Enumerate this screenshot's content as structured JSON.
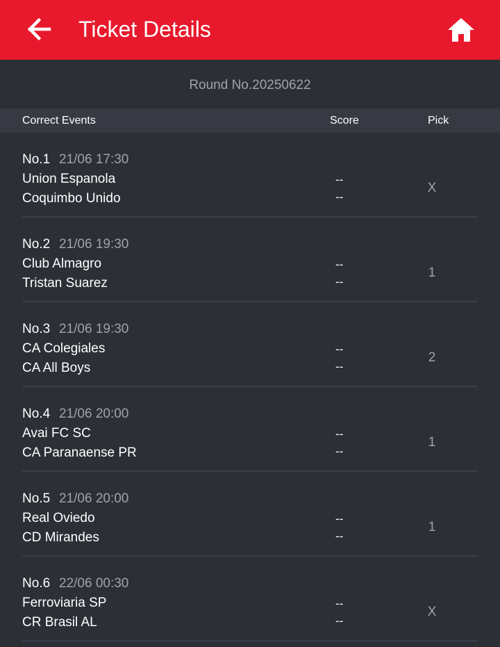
{
  "header": {
    "title": "Ticket Details",
    "back_icon": "arrow-left-icon",
    "home_icon": "home-icon",
    "bar_color": "#e8192c"
  },
  "round": {
    "label": "Round No.20250622"
  },
  "columns": {
    "events": "Correct Events",
    "score": "Score",
    "pick": "Pick"
  },
  "matches": [
    {
      "no": "No.1",
      "time": "21/06 17:30",
      "home": "Union Espanola",
      "away": "Coquimbo Unido",
      "score_home": "--",
      "score_away": "--",
      "pick": "X"
    },
    {
      "no": "No.2",
      "time": "21/06 19:30",
      "home": "Club Almagro",
      "away": "Tristan Suarez",
      "score_home": "--",
      "score_away": "--",
      "pick": "1"
    },
    {
      "no": "No.3",
      "time": "21/06 19:30",
      "home": "CA Colegiales",
      "away": "CA All Boys",
      "score_home": "--",
      "score_away": "--",
      "pick": "2"
    },
    {
      "no": "No.4",
      "time": "21/06 20:00",
      "home": "Avai FC SC",
      "away": "CA Paranaense PR",
      "score_home": "--",
      "score_away": "--",
      "pick": "1"
    },
    {
      "no": "No.5",
      "time": "21/06 20:00",
      "home": "Real Oviedo",
      "away": "CD Mirandes",
      "score_home": "--",
      "score_away": "--",
      "pick": "1"
    },
    {
      "no": "No.6",
      "time": "22/06 00:30",
      "home": "Ferroviaria SP",
      "away": "CR Brasil AL",
      "score_home": "--",
      "score_away": "--",
      "pick": "X"
    }
  ]
}
